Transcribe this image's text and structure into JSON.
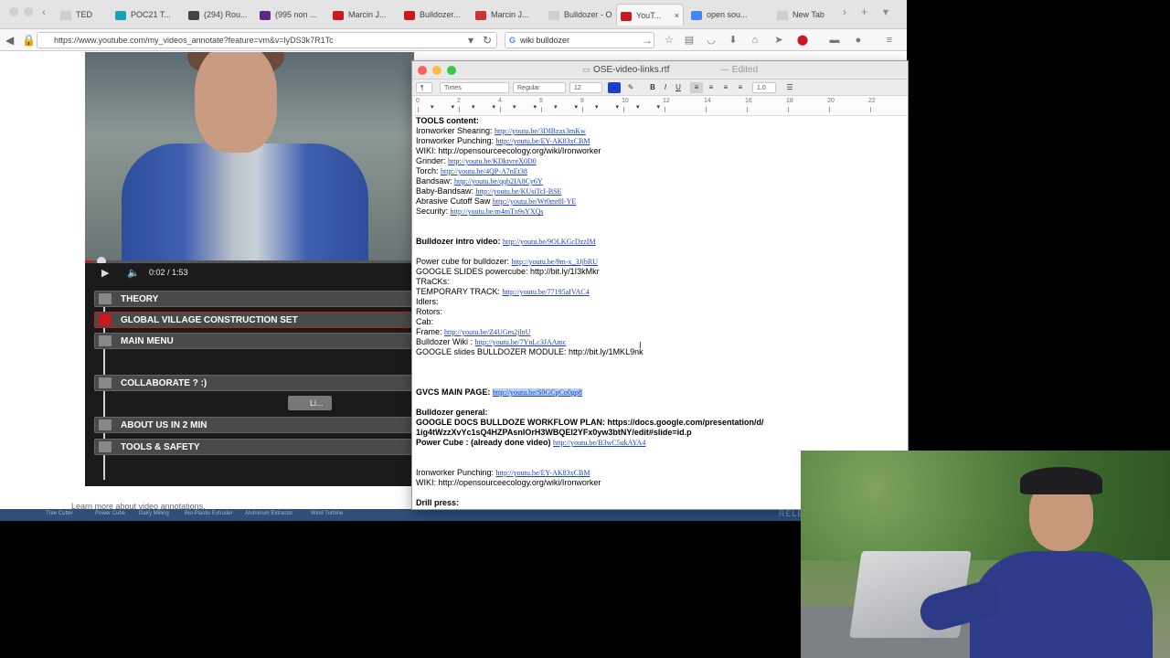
{
  "browser": {
    "tabs": [
      {
        "label": "TED",
        "color": "#cfcfcf"
      },
      {
        "label": "POC21 T...",
        "color": "#1ba1b5"
      },
      {
        "label": "(294) Rou...",
        "color": "#444444"
      },
      {
        "label": "(995 non ...",
        "color": "#5b2a86"
      },
      {
        "label": "Marcin J...",
        "color": "#cc181e"
      },
      {
        "label": "Bulldozer...",
        "color": "#cc181e"
      },
      {
        "label": "Marcin J...",
        "color": "#cc3333"
      },
      {
        "label": "Bulldozer - O...",
        "color": "#cfcfcf"
      },
      {
        "label": "YouT...",
        "color": "#cc181e"
      },
      {
        "label": "open sou...",
        "color": "#4285f4"
      },
      {
        "label": "New Tab",
        "color": "#cfcfcf"
      }
    ],
    "url": "https://www.youtube.com/my_videos_annotate?feature=vm&v=lyDS3k7R1Tc",
    "search_value": "wiki bulldozer"
  },
  "youtube": {
    "time": "0:02 / 1:53",
    "progress_fraction": 0.02,
    "annotations": [
      {
        "label": "THEORY",
        "selected": false
      },
      {
        "label": "GLOBAL VILLAGE CONSTRUCTION SET",
        "selected": true
      },
      {
        "label": "MAIN MENU",
        "selected": false
      },
      {
        "label": "COLLABORATE ? :)",
        "selected": false
      },
      {
        "label": "ABOUT US IN 2 MIN",
        "selected": false
      },
      {
        "label": "TOOLS & SAFETY",
        "selected": false
      }
    ],
    "small_button": "Li...",
    "learn_more": "Learn more about video annotations.",
    "bottom_bar": [
      "Tree Cutter",
      "Power Cube",
      "Dairy Milling",
      "Bio-Plastic Extruder",
      "Aluminum Extractor",
      "Wind Turbine"
    ],
    "released": "RELEASED"
  },
  "textedit": {
    "filename": "OSE-video-links.rtf",
    "status": "— Edited",
    "style_label": "¶",
    "font": "Times",
    "weight": "Regular",
    "size": "12",
    "spacing": "1.0",
    "ruler": [
      "0",
      "2",
      "4",
      "6",
      "8",
      "10",
      "12",
      "14",
      "16",
      "18",
      "20",
      "22"
    ],
    "lines": [
      {
        "bold": "TOOLS content:",
        "text": "",
        "link": ""
      },
      {
        "bold": "",
        "text": "Ironworker Shearing: ",
        "link": "http://youtu.be/3DIBzax3mKw"
      },
      {
        "bold": "",
        "text": "Ironworker Punching: ",
        "link": "http://youtu.be/EY-AK83xCBM"
      },
      {
        "bold": "",
        "text": "WIKI: http://opensourceecology.org/wiki/Ironworker",
        "link": ""
      },
      {
        "bold": "",
        "text": "Grinder: ",
        "link": "http://youtu.be/KDktvreX0D0"
      },
      {
        "bold": "",
        "text": "Torch: ",
        "link": "http://youtu.be/4QP-A7nEt38"
      },
      {
        "bold": "",
        "text": "Bandsaw:  ",
        "link": "http://youtu.be/qqb2IA8Cy6Y"
      },
      {
        "bold": "",
        "text": "Baby-Bandsaw: ",
        "link": "http://youtu.be/KUsiTcI-BSE"
      },
      {
        "bold": "",
        "text": "Abrasive Cutoff Saw ",
        "link": "http://youtu.be/Wr0mr8l-YE"
      },
      {
        "bold": "",
        "text": "Security: ",
        "link": "http://youtu.be/m4mTn9sYXQs"
      },
      {
        "bold": "Bulldozer intro video:",
        "text": " ",
        "link": "http://youtu.be/9OLKGcDzzIM"
      },
      {
        "bold": "",
        "text": "Power cube for bulldozer: ",
        "link": "http://youtu.be/9m-x_3JjbRU"
      },
      {
        "bold": "",
        "text": "GOOGLE SLIDES powercube: http://bit.ly/1I3kMkr",
        "link": ""
      },
      {
        "bold": "",
        "text": "TRaCKs:",
        "link": ""
      },
      {
        "bold": "",
        "text": "TEMPORARY TRACK: ",
        "link": "http://youtu.be/77195aIVAC4"
      },
      {
        "bold": "",
        "text": "Idlers:",
        "link": ""
      },
      {
        "bold": "",
        "text": "Rotors:",
        "link": ""
      },
      {
        "bold": "",
        "text": "Cab:",
        "link": ""
      },
      {
        "bold": "",
        "text": "Frame: ",
        "link": "http://youtu.be/Z4UGes2jlnU"
      },
      {
        "bold": "",
        "text": "Bulldozer Wiki :  ",
        "link": "http://youtu.be/7YnLc3JAAmc"
      },
      {
        "bold": "",
        "text": "GOOGLE slides BULLDOZER MODULE:  http://bit.ly/1MKL9nk",
        "link": ""
      },
      {
        "bold": "GVCS MAIN PAGE:",
        "text": " ",
        "link": "http://youtu.be/S0GCpCo0gp8"
      },
      {
        "bold": "Bulldozer general:",
        "text": "",
        "link": ""
      },
      {
        "bold": "GOOGLE DOCS BULLDOZE WORKFLOW PLAN:  https://docs.google.com/presentation/d/",
        "text": "",
        "link": ""
      },
      {
        "bold": "1ig4tWzzXvYc1sQ4HZPAsnlOrH3WBQEI2YFx0yw3btNY/edit#slide=id.p",
        "text": "",
        "link": ""
      },
      {
        "bold": "Power Cube : (already done video)",
        "text": " ",
        "link": "http://youtu.be/B3wC5ukAYA4"
      },
      {
        "bold": "",
        "text": "Ironworker Punching: ",
        "link": "http://youtu.be/EY-AK83xCBM"
      },
      {
        "bold": "",
        "text": "WIKI: http://opensourceecology.org/wiki/Ironworker",
        "link": ""
      },
      {
        "bold": "Drill press:",
        "text": "",
        "link": ""
      }
    ]
  }
}
